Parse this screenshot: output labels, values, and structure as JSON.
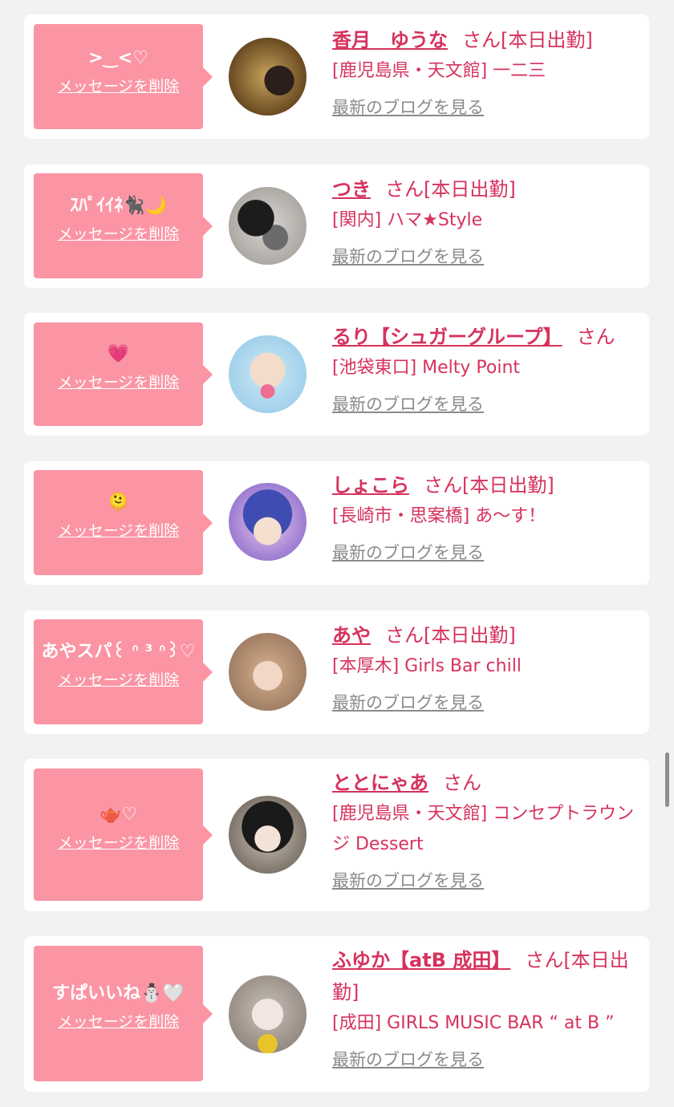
{
  "delete_label": "メッセージを削除",
  "blog_label": "最新のブログを見る",
  "san_label": "さん",
  "colors": {
    "accent": "#d6325c",
    "message_bg": "#fb95a4",
    "card_bg": "#ffffff",
    "page_bg": "#f2f2f2",
    "link_gray": "#8a8a8a"
  },
  "entries": [
    {
      "message": ">‿<♡",
      "name": "香月　ゆうな",
      "status": "[本日出勤]",
      "shop": "[鹿児島県・天文館] 一二三"
    },
    {
      "message": "ｽﾊﾟｲｲﾈ🐈‍⬛🌙",
      "name": "つき",
      "status": "[本日出勤]",
      "shop": "[関内] ハマ★Style"
    },
    {
      "message": "💗",
      "name": "るり【シュガーグループ】",
      "status": "",
      "shop": "[池袋東口] Melty Point"
    },
    {
      "message": "🫠",
      "name": "しょこら",
      "status": "[本日出勤]",
      "shop": "[長崎市・思案橋] あ〜す！"
    },
    {
      "message": "あやスパ꒰ ᐢ ³ ᐢ꒱♡",
      "name": "あや",
      "status": "[本日出勤]",
      "shop": "[本厚木] Girls Bar chill"
    },
    {
      "message": "🫖♡",
      "name": "ととにゃあ",
      "status": "",
      "shop": "[鹿児島県・天文館] コンセプトラウンジ Dessert"
    },
    {
      "message": "すぱいいね⛄🤍",
      "name": "ふゆか【atB 成田】",
      "status": "[本日出勤]",
      "shop": "[成田] GIRLS MUSIC BAR “ at B ”"
    }
  ]
}
